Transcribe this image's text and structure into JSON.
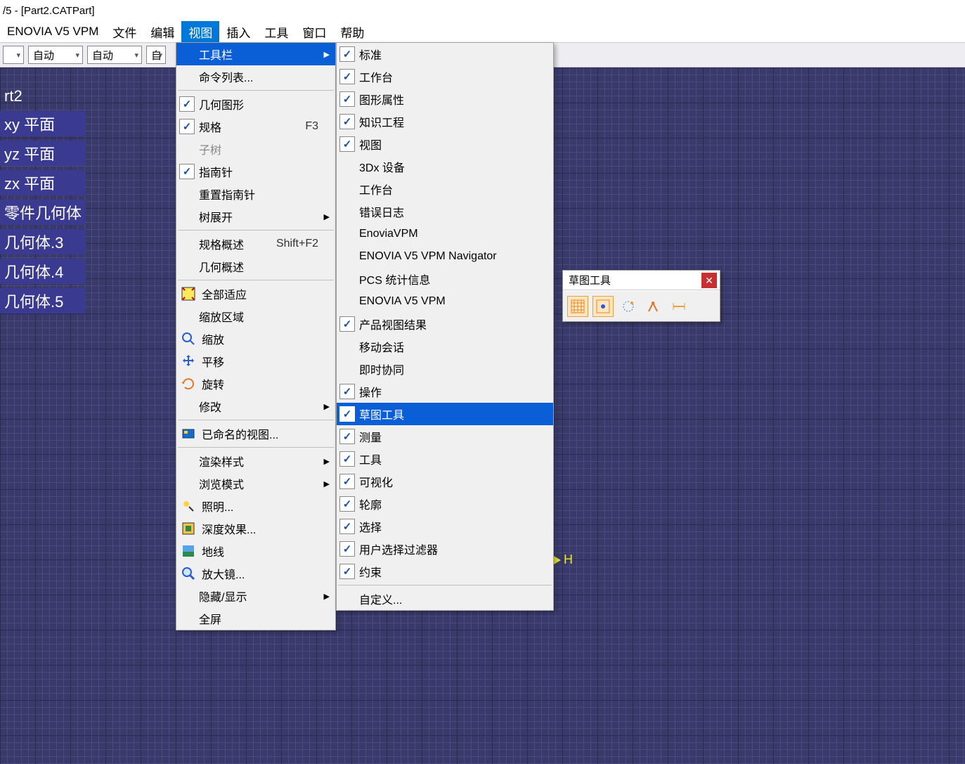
{
  "title": "/5 - [Part2.CATPart]",
  "menubar": [
    "ENOVIA V5 VPM",
    "文件",
    "编辑",
    "视图",
    "插入",
    "工具",
    "窗口",
    "帮助"
  ],
  "menubar_active_index": 3,
  "toolbar_combos": [
    "",
    "自动",
    "自动",
    "自"
  ],
  "tree": [
    "rt2",
    "xy 平面",
    "yz 平面",
    "zx 平面",
    "零件几何体",
    "几何体.3",
    "几何体.4",
    "几何体.5"
  ],
  "dropdown1": [
    {
      "type": "item",
      "label": "工具栏",
      "hl": true,
      "arrow": true,
      "spacer": true
    },
    {
      "type": "item",
      "label": "命令列表...",
      "spacer": true
    },
    {
      "type": "sep"
    },
    {
      "type": "item",
      "label": "几何图形",
      "check": true
    },
    {
      "type": "item",
      "label": "规格",
      "check": true,
      "shortcut": "F3"
    },
    {
      "type": "item",
      "label": "子树",
      "spacer": true,
      "disabled": true
    },
    {
      "type": "item",
      "label": "指南针",
      "check": true
    },
    {
      "type": "item",
      "label": "重置指南针",
      "spacer": true
    },
    {
      "type": "item",
      "label": "树展开",
      "spacer": true,
      "arrow": true
    },
    {
      "type": "sep"
    },
    {
      "type": "item",
      "label": "规格概述",
      "spacer": true,
      "shortcut": "Shift+F2"
    },
    {
      "type": "item",
      "label": "几何概述",
      "spacer": true
    },
    {
      "type": "sep"
    },
    {
      "type": "item",
      "label": "全部适应",
      "icon": "fit-all"
    },
    {
      "type": "item",
      "label": "缩放区域",
      "spacer": true
    },
    {
      "type": "item",
      "label": "缩放",
      "icon": "zoom"
    },
    {
      "type": "item",
      "label": "平移",
      "icon": "pan"
    },
    {
      "type": "item",
      "label": "旋转",
      "icon": "rotate"
    },
    {
      "type": "item",
      "label": "修改",
      "spacer": true,
      "arrow": true
    },
    {
      "type": "sep"
    },
    {
      "type": "item",
      "label": "已命名的视图...",
      "icon": "named-view"
    },
    {
      "type": "sep"
    },
    {
      "type": "item",
      "label": "渲染样式",
      "spacer": true,
      "arrow": true
    },
    {
      "type": "item",
      "label": "浏览模式",
      "spacer": true,
      "arrow": true
    },
    {
      "type": "item",
      "label": "照明...",
      "icon": "lighting"
    },
    {
      "type": "item",
      "label": "深度效果...",
      "icon": "depth"
    },
    {
      "type": "item",
      "label": "地线",
      "icon": "ground"
    },
    {
      "type": "item",
      "label": "放大镜...",
      "icon": "magnifier"
    },
    {
      "type": "item",
      "label": "隐藏/显示",
      "spacer": true,
      "arrow": true
    },
    {
      "type": "item",
      "label": "全屏",
      "spacer": true
    }
  ],
  "dropdown2": [
    {
      "type": "item",
      "label": "标准",
      "check": true
    },
    {
      "type": "item",
      "label": "工作台",
      "check": true
    },
    {
      "type": "item",
      "label": "图形属性",
      "check": true
    },
    {
      "type": "item",
      "label": "知识工程",
      "check": true
    },
    {
      "type": "item",
      "label": "视图",
      "check": true
    },
    {
      "type": "item",
      "label": "3Dx 设备",
      "spacer": true
    },
    {
      "type": "item",
      "label": "工作台",
      "spacer": true
    },
    {
      "type": "item",
      "label": "错误日志",
      "spacer": true
    },
    {
      "type": "item",
      "label": "EnoviaVPM",
      "spacer": true
    },
    {
      "type": "item",
      "label": "ENOVIA V5 VPM Navigator",
      "spacer": true
    },
    {
      "type": "item",
      "label": "PCS 统计信息",
      "spacer": true
    },
    {
      "type": "item",
      "label": "ENOVIA V5 VPM",
      "spacer": true
    },
    {
      "type": "item",
      "label": "产品视图结果",
      "check": true
    },
    {
      "type": "item",
      "label": "移动会话",
      "spacer": true
    },
    {
      "type": "item",
      "label": "即时协同",
      "spacer": true
    },
    {
      "type": "item",
      "label": "操作",
      "check": true
    },
    {
      "type": "item",
      "label": "草图工具",
      "check": true,
      "hl": true
    },
    {
      "type": "item",
      "label": "测量",
      "check": true
    },
    {
      "type": "item",
      "label": "工具",
      "check": true
    },
    {
      "type": "item",
      "label": "可视化",
      "check": true
    },
    {
      "type": "item",
      "label": "轮廓",
      "check": true
    },
    {
      "type": "item",
      "label": "选择",
      "check": true
    },
    {
      "type": "item",
      "label": "用户选择过滤器",
      "check": true
    },
    {
      "type": "item",
      "label": "约束",
      "check": true
    },
    {
      "type": "sep"
    },
    {
      "type": "item",
      "label": "自定义...",
      "spacer": true
    }
  ],
  "floatbar": {
    "title": "草图工具",
    "icons": [
      "grid",
      "snap",
      "construction",
      "constraint",
      "dim"
    ]
  },
  "axis_label": "H"
}
